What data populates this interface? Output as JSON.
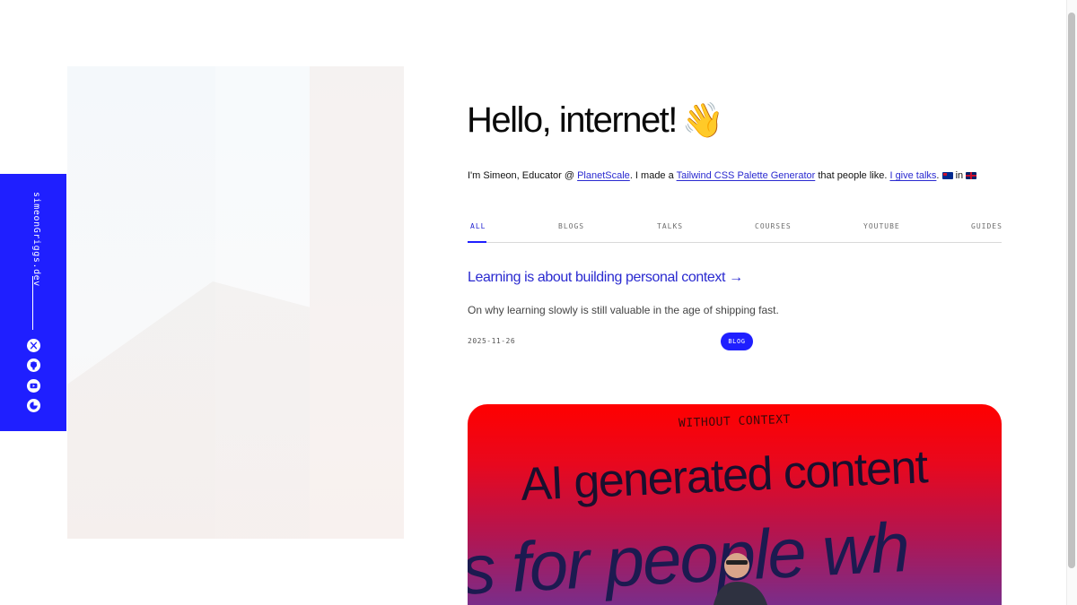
{
  "sidebar": {
    "site_name": "simeonGriggs.dev",
    "icons": [
      "x-icon",
      "github-icon",
      "youtube-icon",
      "theme-toggle-icon"
    ]
  },
  "hero": {
    "greeting": "Hello, internet!",
    "emoji": "👋"
  },
  "intro": {
    "prefix": "I'm Simeon, Educator @ ",
    "link_company": "PlanetScale",
    "middle": ". I made a ",
    "link_tool": "Tailwind CSS Palette Generator",
    "after_tool": " that people like. ",
    "link_talks": "I give talks",
    "after_talks": ".",
    "in_word": " in "
  },
  "tabs": [
    {
      "label": "ALL",
      "active": true
    },
    {
      "label": "BLOGS",
      "active": false
    },
    {
      "label": "TALKS",
      "active": false
    },
    {
      "label": "COURSES",
      "active": false
    },
    {
      "label": "YOUTUBE",
      "active": false
    },
    {
      "label": "GUIDES",
      "active": false
    }
  ],
  "post": {
    "title": "Learning is about building personal context",
    "arrow": "→",
    "description": "On why learning slowly is still valuable in the age of shipping fast.",
    "date": "2025-11-26",
    "badge": "BLOG",
    "thumbnail": {
      "small_text": "WITHOUT CONTEXT",
      "big_text": "AI generated content",
      "big_text_2": "s for people wh"
    }
  },
  "colors": {
    "accent": "#1f1fff",
    "link": "#2a2ad0",
    "thumb_top": "#ff0000",
    "thumb_bottom": "#7a2d8a"
  }
}
